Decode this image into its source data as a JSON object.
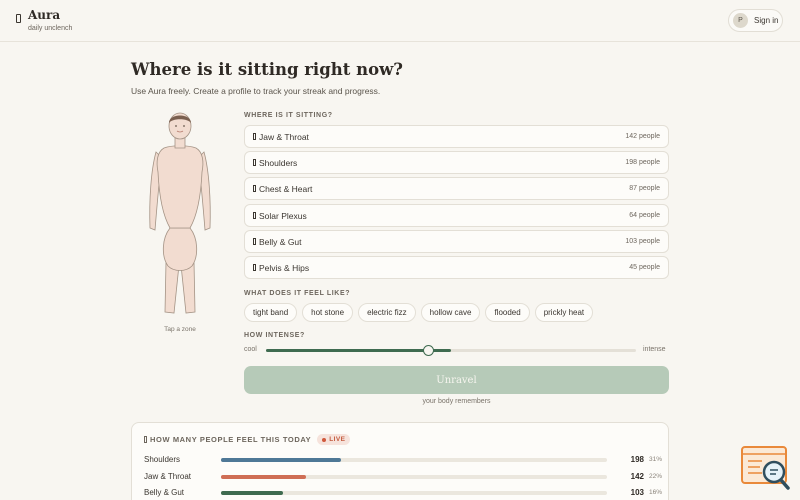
{
  "header": {
    "brand": "Aura",
    "tagline": "daily unclench",
    "signin_avatar": "P",
    "signin_label": "Sign in"
  },
  "intro": {
    "title": "Where is it sitting right now?",
    "subtitle": "Use Aura freely. Create a profile to track your streak and progress."
  },
  "figure": {
    "hint": "Tap a zone"
  },
  "zones": {
    "label": "WHERE IS IT SITTING?",
    "items": [
      {
        "name": "Jaw & Throat",
        "count": "142 people"
      },
      {
        "name": "Shoulders",
        "count": "198 people"
      },
      {
        "name": "Chest & Heart",
        "count": "87 people"
      },
      {
        "name": "Solar Plexus",
        "count": "64 people"
      },
      {
        "name": "Belly & Gut",
        "count": "103 people"
      },
      {
        "name": "Pelvis & Hips",
        "count": "45 people"
      }
    ]
  },
  "feelings": {
    "label": "WHAT DOES IT FEEL LIKE?",
    "chips": [
      "tight band",
      "hot stone",
      "electric fizz",
      "hollow cave",
      "flooded",
      "prickly heat"
    ]
  },
  "intensity": {
    "label": "HOW INTENSE?",
    "min_label": "cool",
    "max_label": "intense",
    "value": 0.44,
    "fill": 0.5
  },
  "action": {
    "button": "Unravel",
    "note": "your body remembers"
  },
  "stats": {
    "title": "HOW MANY PEOPLE FEEL THIS TODAY",
    "badge": "LIVE",
    "rows": [
      {
        "name": "Shoulders",
        "value": "198",
        "pct": "31%",
        "fraction": 0.31,
        "color": "#4e7896"
      },
      {
        "name": "Jaw & Throat",
        "value": "142",
        "pct": "22%",
        "fraction": 0.22,
        "color": "#cf6e55"
      },
      {
        "name": "Belly & Gut",
        "value": "103",
        "pct": "16%",
        "fraction": 0.16,
        "color": "#3f6b50"
      }
    ]
  },
  "colors": {
    "accent": "#3f6b50",
    "button_disabled": "#b6cab8",
    "live": "#d0593c",
    "background": "#f8f6f1"
  },
  "icons": {
    "brand": "leaf-icon",
    "zone": "dot-icon",
    "stats": "chart-icon",
    "widget": "search-chat-icon"
  }
}
